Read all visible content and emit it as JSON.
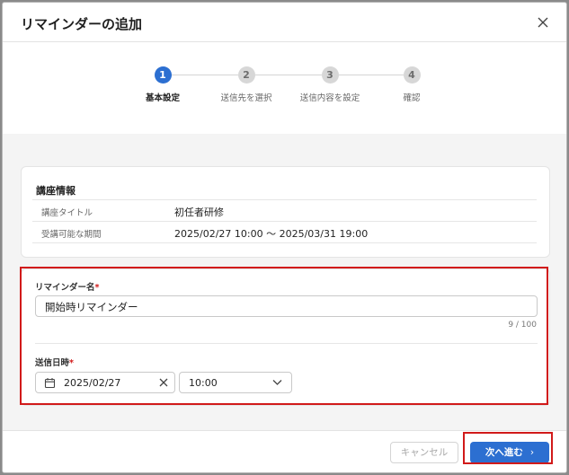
{
  "dialog": {
    "title": "リマインダーの追加"
  },
  "stepper": {
    "steps": [
      {
        "number": "1",
        "label": "基本設定"
      },
      {
        "number": "2",
        "label": "送信先を選択"
      },
      {
        "number": "3",
        "label": "送信内容を設定"
      },
      {
        "number": "4",
        "label": "確認"
      }
    ],
    "active_step": 1
  },
  "course_info": {
    "heading": "講座情報",
    "rows": [
      {
        "key": "講座タイトル",
        "value": "初任者研修"
      },
      {
        "key": "受講可能な期間",
        "value": "2025/02/27 10:00 〜 2025/03/31 19:00"
      }
    ]
  },
  "form": {
    "name_label": "リマインダー名",
    "required_mark": "*",
    "name_value": "開始時リマインダー",
    "name_counter": "9 / 100",
    "send_label": "送信日時",
    "date_value": "2025/02/27",
    "time_value": "10:00"
  },
  "footer": {
    "cancel_label": "キャンセル",
    "next_label": "次へ進む",
    "next_arrow": "›"
  },
  "colors": {
    "accent": "#2c6fd1",
    "highlight": "#d11a1a",
    "required": "#d11a1a"
  },
  "icons": [
    "close-icon",
    "calendar-icon",
    "clear-icon",
    "chevron-down-icon",
    "chevron-right-icon"
  ]
}
